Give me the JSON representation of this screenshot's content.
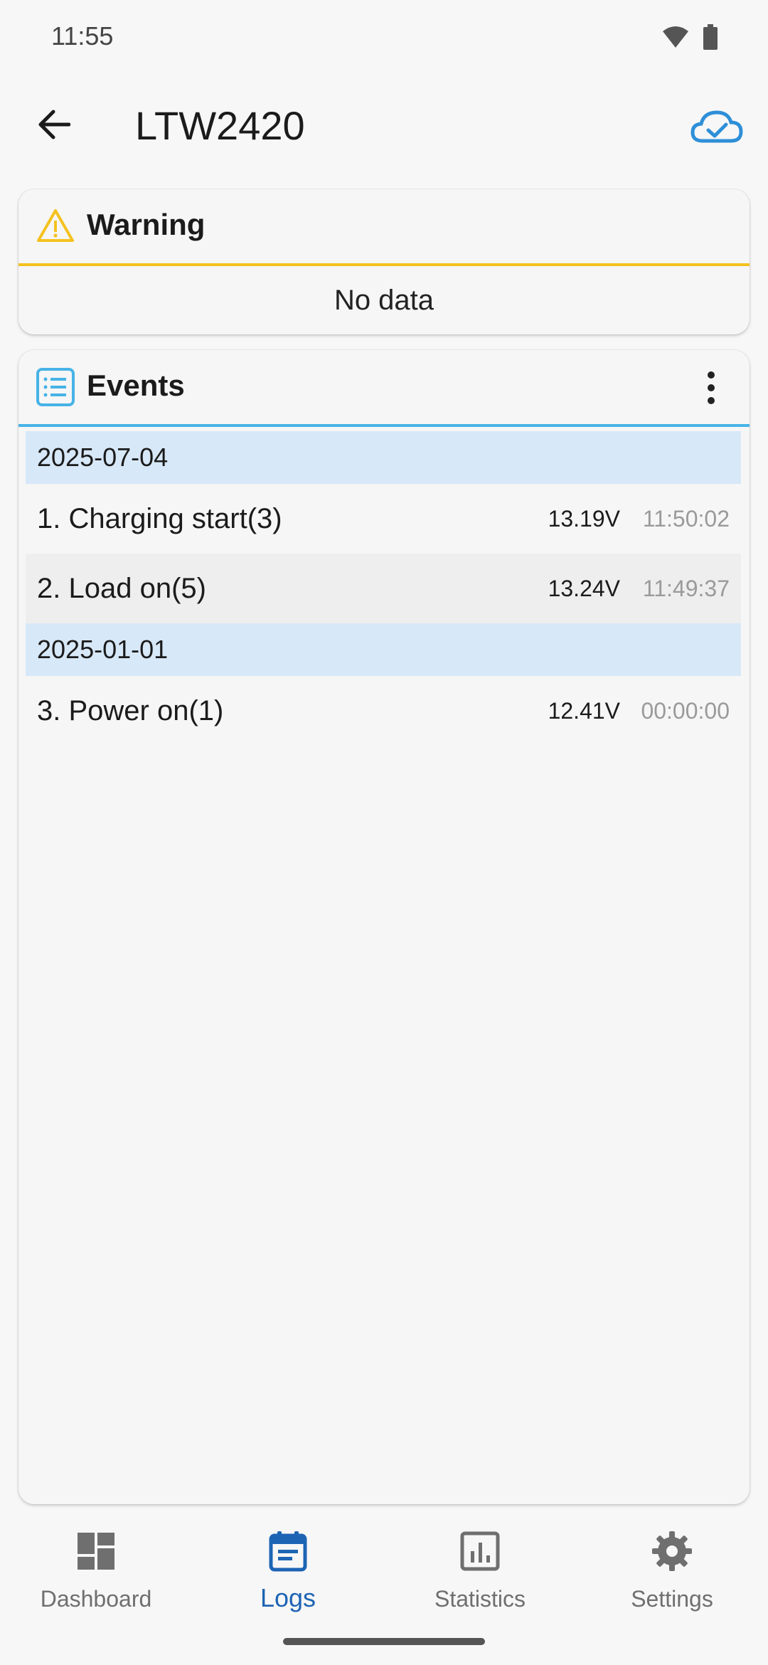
{
  "status_bar": {
    "time": "11:55",
    "icons": [
      "wifi-icon",
      "battery-icon"
    ]
  },
  "app_bar": {
    "title": "LTW2420",
    "back_icon": "arrow-left-icon",
    "sync_icon": "cloud-check-icon"
  },
  "warning_card": {
    "title": "Warning",
    "body": "No data",
    "accent": "#f4c21f"
  },
  "events_card": {
    "title": "Events",
    "accent": "#47b3e6",
    "groups": [
      {
        "date": "2025-07-04",
        "events": [
          {
            "label": "1. Charging start(3)",
            "voltage": "13.19V",
            "time": "11:50:02"
          },
          {
            "label": "2. Load on(5)",
            "voltage": "13.24V",
            "time": "11:49:37"
          }
        ]
      },
      {
        "date": "2025-01-01",
        "events": [
          {
            "label": "3. Power on(1)",
            "voltage": "12.41V",
            "time": "00:00:00"
          }
        ]
      }
    ]
  },
  "bottom_nav": {
    "items": [
      {
        "label": "Dashboard",
        "icon": "dashboard-icon"
      },
      {
        "label": "Logs",
        "icon": "calendar-icon",
        "active": true
      },
      {
        "label": "Statistics",
        "icon": "bar-chart-icon"
      },
      {
        "label": "Settings",
        "icon": "gear-icon"
      }
    ],
    "active_color": "#1e64b4"
  }
}
